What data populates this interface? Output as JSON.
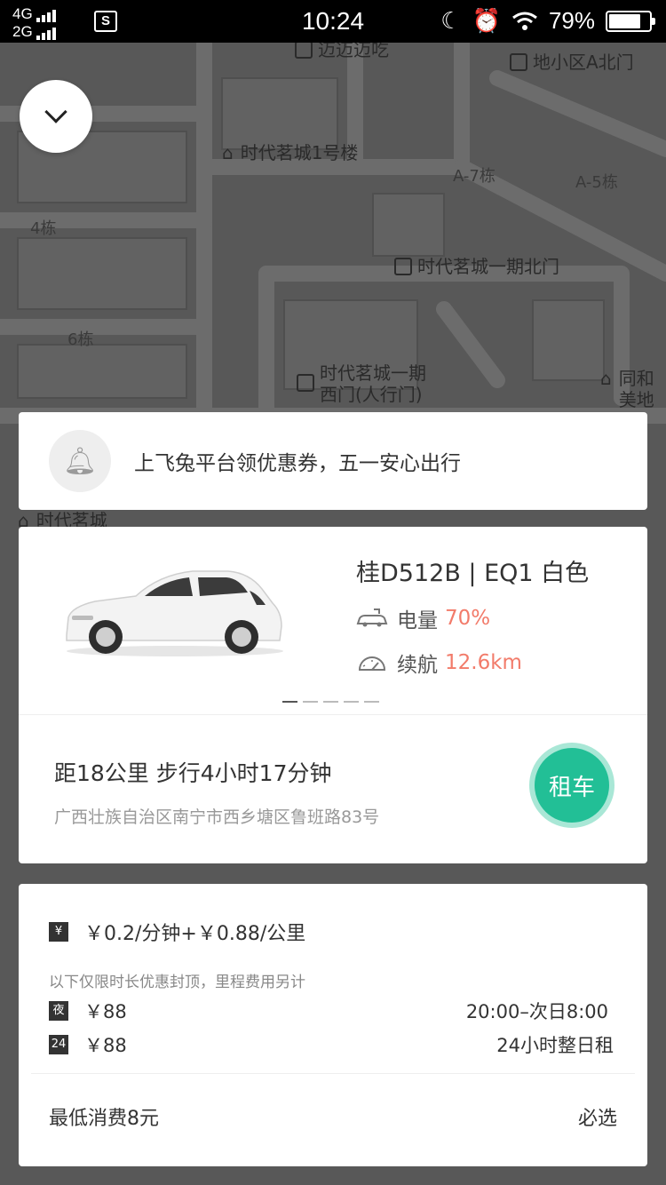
{
  "status_bar": {
    "network_top": "4G",
    "network_bottom": "2G",
    "sim_badge": "S",
    "time": "10:24",
    "battery_percent": "79%",
    "battery_level": 0.79
  },
  "map": {
    "labels": {
      "top_left": "迈迈迈吃",
      "top_right": "地小区A北门",
      "building1": "时代茗城1号楼",
      "a7": "A-7栋",
      "a5": "A-5栋",
      "b4": "4栋",
      "north_gate": "时代茗城一期北门",
      "b6": "6栋",
      "west_gate_1": "时代茗城一期",
      "west_gate_2": "西门(人行门)",
      "right_edge_1": "同和",
      "right_edge_2": "美地",
      "bottom_left": "时代茗城"
    }
  },
  "notice": {
    "text": "上飞兔平台领优惠券，五一安心出行"
  },
  "car": {
    "plate_info": "桂D512B | EQ1  白色",
    "battery_label": "电量",
    "battery_value": "70%",
    "range_label": "续航",
    "range_value": "12.6km",
    "carousel_count": 5,
    "carousel_active": 0,
    "distance_text": "距18公里 步行4小时17分钟",
    "address": "广西壮族自治区南宁市西乡塘区鲁班路83号",
    "rent_button": "租车"
  },
  "pricing": {
    "main_tag": "¥",
    "main_price": "￥0.2/分钟+￥0.88/公里",
    "note": "以下仅限时长优惠封顶，里程费用另计",
    "night_tag": "夜",
    "night_price": "￥88",
    "night_time": "20:00–次日8:00",
    "day_tag": "24",
    "day_price": "￥88",
    "day_desc": "24小时整日租",
    "min_charge": "最低消费8元",
    "required": "必选"
  },
  "colors": {
    "accent_green": "#22bf96",
    "highlight_red": "#f27b6a",
    "map_overlay": "#585858"
  }
}
